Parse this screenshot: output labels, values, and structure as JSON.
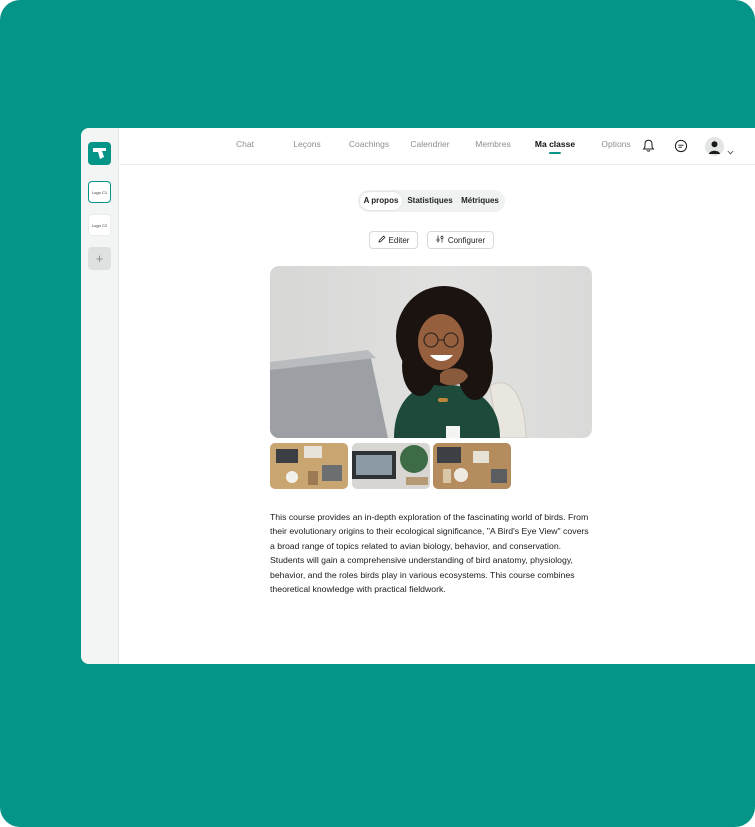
{
  "colors": {
    "brand": "#049488",
    "background": "#049488",
    "nav_active": "#111111",
    "nav_inactive": "#8a8f94"
  },
  "sidebar": {
    "logo_icon": "whiteboard-logo-icon",
    "workspaces": [
      {
        "label": "Logo C1",
        "active": true
      },
      {
        "label": "Logo C2",
        "active": false
      }
    ],
    "add_label": "+"
  },
  "nav": {
    "items": [
      {
        "label": "Chat"
      },
      {
        "label": "Leçons"
      },
      {
        "label": "Coachings"
      },
      {
        "label": "Calendrier"
      },
      {
        "label": "Membres"
      },
      {
        "label": "Ma classe",
        "active": true
      },
      {
        "label": "Options"
      }
    ],
    "icons": [
      "bell-icon",
      "chat-bubble-icon",
      "user-avatar-icon",
      "chevron-down-icon"
    ]
  },
  "tabs": [
    {
      "label": "A propos",
      "active": true
    },
    {
      "label": "Statistiques"
    },
    {
      "label": "Métriques"
    }
  ],
  "actions": {
    "edit_label": "Editer",
    "configure_label": "Configurer"
  },
  "media": {
    "hero_alt": "woman smiling with laptop",
    "thumbnails": [
      "desk-flatlay-1",
      "laptop-desk-2",
      "desk-flatlay-3"
    ]
  },
  "description": "This course provides an in-depth exploration of the fascinating world of birds. From their evolutionary origins to their ecological significance, \"A Bird's Eye View\" covers a broad range of topics related to avian biology, behavior, and conservation. Students will gain a comprehensive understanding of bird anatomy, physiology, behavior, and the roles birds play in various ecosystems. This course combines theoretical knowledge with practical fieldwork."
}
